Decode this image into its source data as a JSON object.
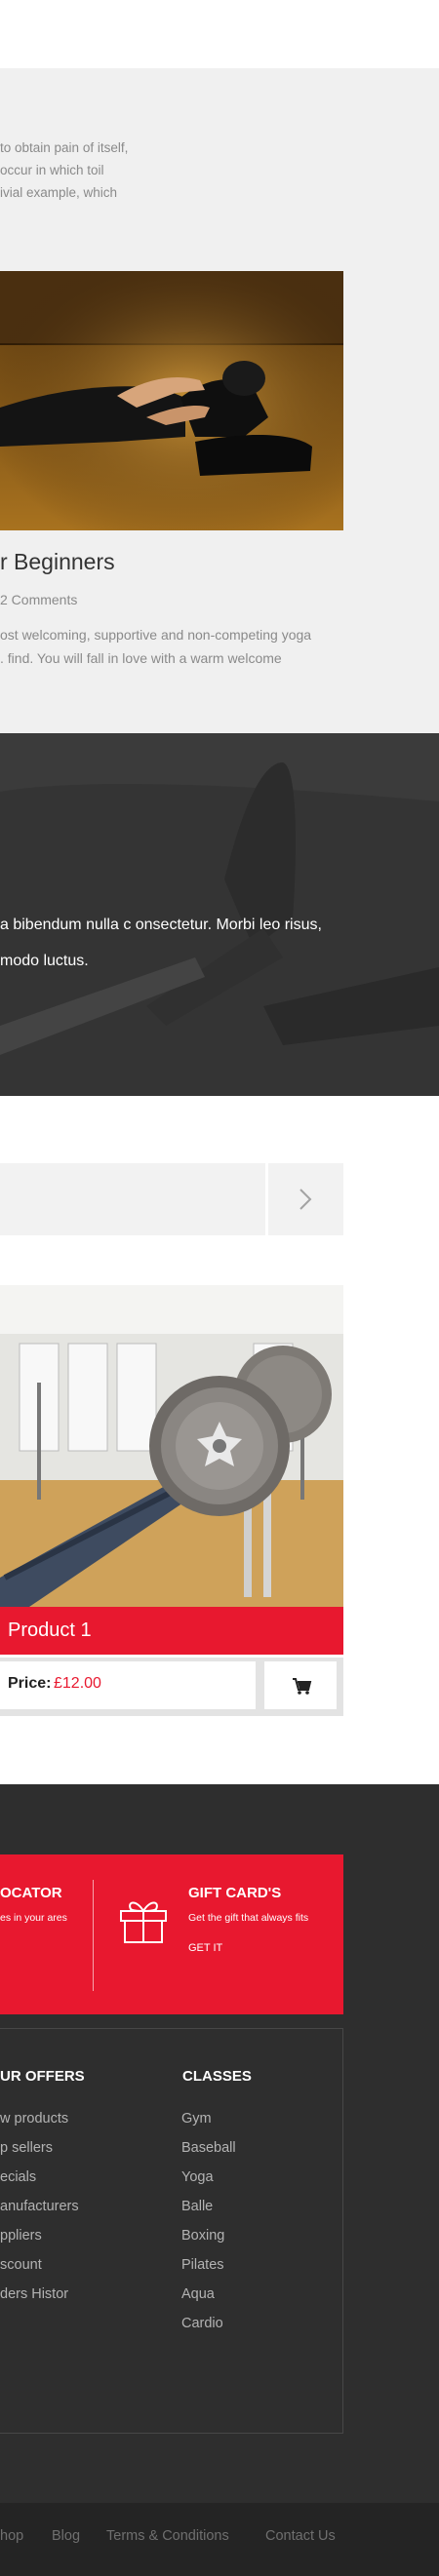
{
  "blog": {
    "intro_lines": [
      "to obtain pain of itself,",
      "occur in which toil",
      "ivial example, which"
    ],
    "post_title": "r Beginners",
    "post_comments": "2 Comments",
    "post_text_lines": [
      "ost welcoming, supportive and non-competing yoga",
      ". find. You will fall in love with a warm welcome"
    ]
  },
  "testimonial": {
    "lines": [
      "a bibendum nulla c onsectetur. Morbi leo risus,",
      "modo luctus."
    ]
  },
  "slider": {
    "next_icon": "chevron-right-icon"
  },
  "product": {
    "name": "Product 1",
    "price_label": "Price:",
    "price_value": "£12.00",
    "cart_icon": "cart-icon"
  },
  "footer": {
    "promo": {
      "locator_title": "OCATOR",
      "locator_sub": "es in your ares",
      "gift_title": "GIFT CARD'S",
      "gift_sub": "Get the gift that always fits",
      "gift_link": "GET IT",
      "gift_icon": "gift-icon"
    },
    "offers": {
      "heading": "UR OFFERS",
      "items": [
        "w products",
        "p sellers",
        "ecials",
        "anufacturers",
        "ppliers",
        "scount",
        "ders Histor"
      ]
    },
    "classes": {
      "heading": "CLASSES",
      "items": [
        "Gym",
        "Baseball",
        "Yoga",
        "Balle",
        "Boxing",
        "Pilates",
        "Aqua",
        "Cardio"
      ]
    },
    "bottom_links": [
      "hop",
      "Blog",
      "Terms & Conditions",
      "Contact Us"
    ]
  },
  "colors": {
    "accent": "#e8182f",
    "footer_bg": "#2e2e2e",
    "section_bg": "#f0f0f0"
  }
}
